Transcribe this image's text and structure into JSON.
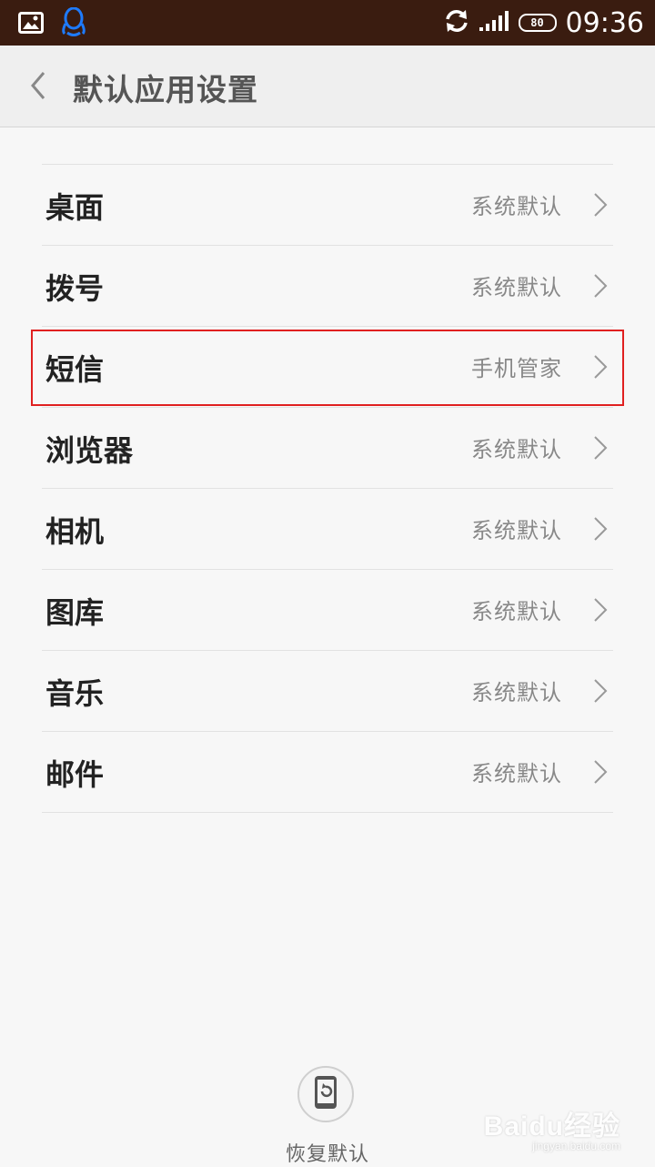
{
  "status_bar": {
    "time": "09:36",
    "battery_text": "80",
    "icons": [
      "image-icon",
      "qq-icon",
      "sync-icon",
      "signal-icon",
      "battery-icon"
    ]
  },
  "header": {
    "title": "默认应用设置",
    "back_icon": "chevron-left-icon"
  },
  "list": {
    "items": [
      {
        "label": "桌面",
        "value": "系统默认"
      },
      {
        "label": "拨号",
        "value": "系统默认"
      },
      {
        "label": "短信",
        "value": "手机管家"
      },
      {
        "label": "浏览器",
        "value": "系统默认"
      },
      {
        "label": "相机",
        "value": "系统默认"
      },
      {
        "label": "图库",
        "value": "系统默认"
      },
      {
        "label": "音乐",
        "value": "系统默认"
      },
      {
        "label": "邮件",
        "value": "系统默认"
      }
    ]
  },
  "footer": {
    "restore_label": "恢复默认",
    "restore_icon": "restore-phone-icon"
  },
  "watermark": {
    "main": "Baidu经验",
    "sub": "jingyan.baidu.com"
  },
  "colors": {
    "status_bar": "#3a1c10",
    "highlight": "#e02020",
    "background": "#f7f7f7"
  }
}
